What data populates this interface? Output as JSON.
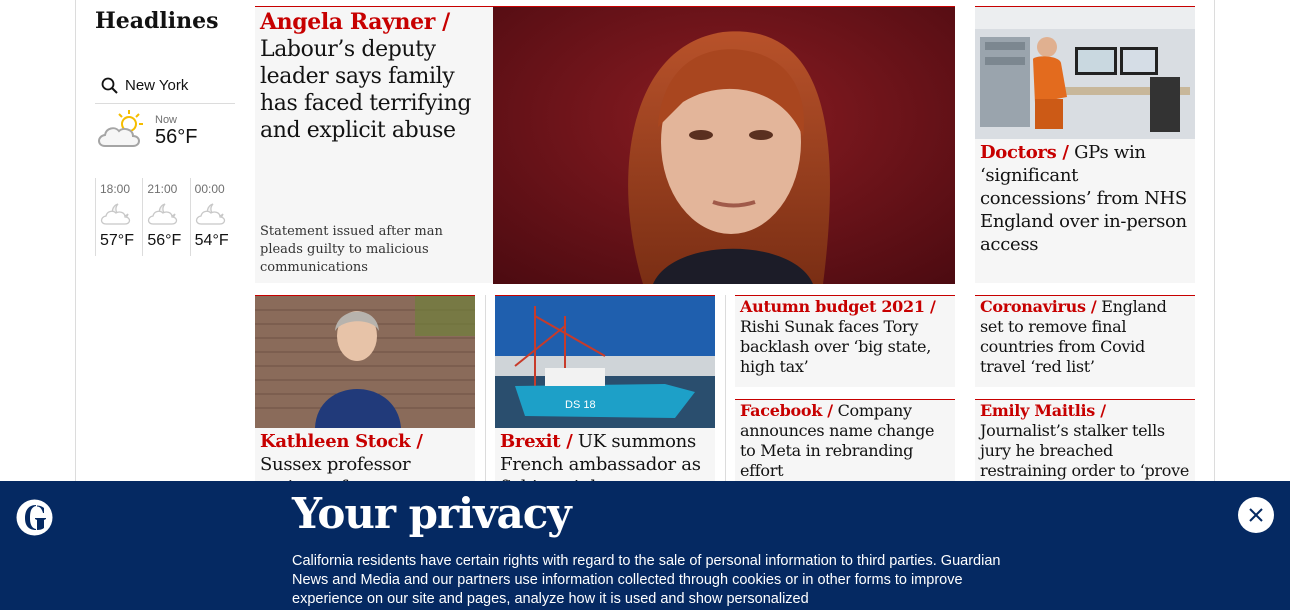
{
  "headlines": {
    "title": "Headlines",
    "location": "New York",
    "now_label": "Now",
    "now_temp": "56°F",
    "now_icon": "partly-cloudy-day-icon",
    "forecast": [
      {
        "time": "18:00",
        "temp": "57°F",
        "icon": "cloudy-night-icon"
      },
      {
        "time": "21:00",
        "temp": "56°F",
        "icon": "cloudy-night-icon"
      },
      {
        "time": "00:00",
        "temp": "54°F",
        "icon": "cloudy-night-icon"
      }
    ]
  },
  "stories": {
    "main": {
      "kicker": "Angela Rayner /",
      "headline": "Labour’s deputy leader says family has faced terrifying and explicit abuse",
      "standfirst": "Statement issued after man pleads guilty to malicious communications"
    },
    "doctors": {
      "kicker": "Doctors /",
      "headline": "GPs win ‘significant concessions’ from NHS England over in-person access"
    },
    "stock": {
      "kicker": "Kathleen Stock /",
      "headline": "Sussex professor resigns after"
    },
    "brexit": {
      "kicker": "Brexit /",
      "headline": "UK summons French ambassador as fishing rights"
    },
    "budget": {
      "kicker": "Autumn budget 2021 /",
      "headline": "Rishi Sunak faces Tory backlash over ‘big state, high tax’"
    },
    "facebook": {
      "kicker": "Facebook /",
      "headline": "Company announces name change to Meta in rebranding effort"
    },
    "coronavirus": {
      "kicker": "Coronavirus /",
      "headline": "England set to remove final countries from Covid travel ‘red list’"
    },
    "maitlis": {
      "kicker": "Emily Maitlis /",
      "headline": "Journalist’s stalker tells jury he breached restraining order to ‘prove innocence’"
    }
  },
  "privacy": {
    "title": "Your privacy",
    "text": "California residents have certain rights with regard to the sale of personal information to third parties. Guardian News and Media and our partners use information collected through cookies or in other forms to improve experience on our site and pages, analyze how it is used and show personalized"
  },
  "colors": {
    "accent": "#c70000",
    "banner": "#052962",
    "card_bg": "#f6f6f6"
  }
}
